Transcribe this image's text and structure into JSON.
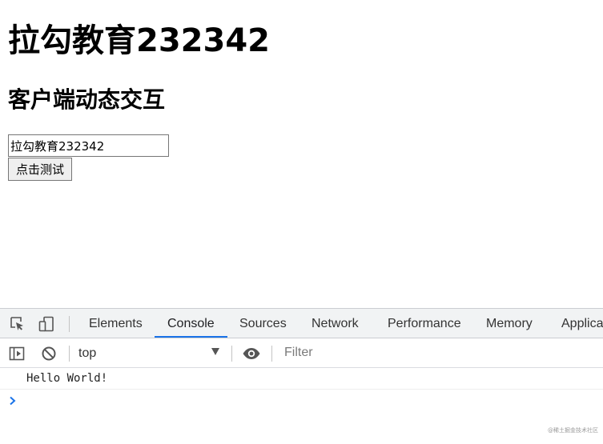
{
  "page": {
    "heading": "拉勾教育232342",
    "subheading": "客户端动态交互",
    "input_value": "拉勾教育232342",
    "button_label": "点击测试"
  },
  "devtools": {
    "tabs": [
      {
        "label": "Elements"
      },
      {
        "label": "Console"
      },
      {
        "label": "Sources"
      },
      {
        "label": "Network"
      },
      {
        "label": "Performance"
      },
      {
        "label": "Memory"
      },
      {
        "label": "Applica"
      }
    ],
    "active_tab": "Console",
    "context": "top",
    "filter_placeholder": "Filter",
    "log": [
      "Hello World!"
    ],
    "accent_color": "#1a73e8"
  },
  "watermark": "@稀土掘金技术社区"
}
